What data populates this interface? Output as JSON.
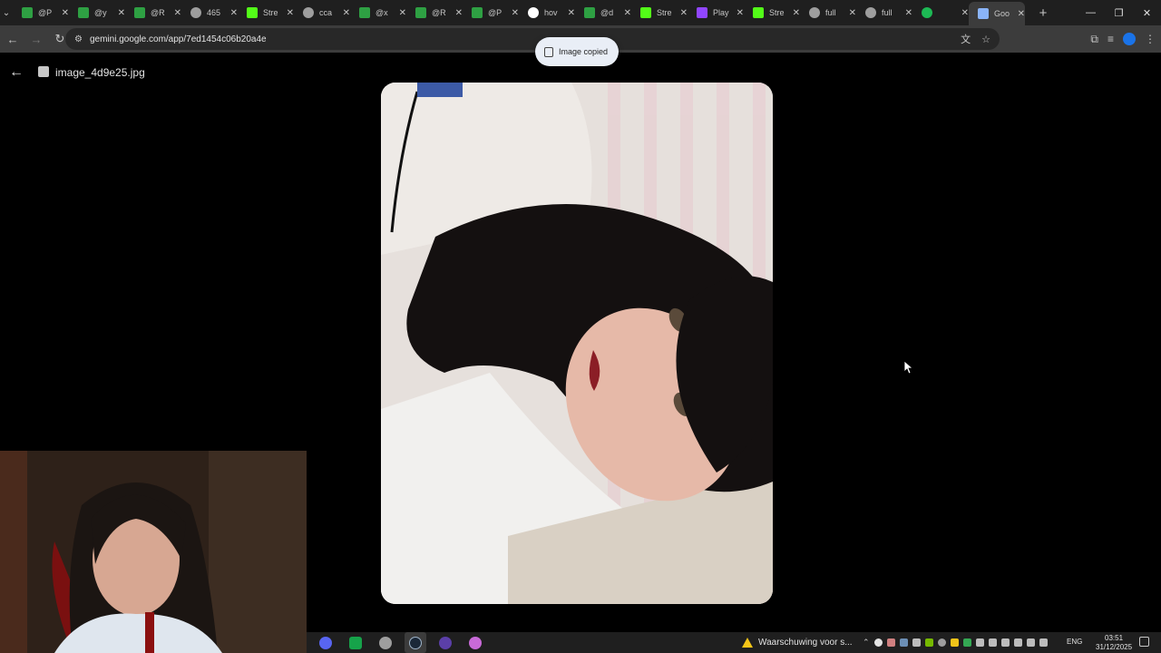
{
  "browser": {
    "tabs": [
      {
        "title": "@P",
        "favicon": "green-square-icon",
        "color": "#2ea043"
      },
      {
        "title": "@y",
        "favicon": "green-square-icon",
        "color": "#2ea043"
      },
      {
        "title": "@R",
        "favicon": "green-square-icon",
        "color": "#2ea043"
      },
      {
        "title": "465",
        "favicon": "globe-icon",
        "color": "#9e9e9e"
      },
      {
        "title": "Stre",
        "favicon": "kick-icon",
        "color": "#53fc18"
      },
      {
        "title": "cca",
        "favicon": "globe-icon",
        "color": "#9e9e9e"
      },
      {
        "title": "@x",
        "favicon": "green-square-icon",
        "color": "#2ea043"
      },
      {
        "title": "@R",
        "favicon": "green-square-icon",
        "color": "#2ea043"
      },
      {
        "title": "@P",
        "favicon": "green-square-icon",
        "color": "#2ea043"
      },
      {
        "title": "hov",
        "favicon": "google-icon",
        "color": "#ffffff"
      },
      {
        "title": "@d",
        "favicon": "green-square-icon",
        "color": "#2ea043"
      },
      {
        "title": "Stre",
        "favicon": "kick-icon",
        "color": "#53fc18"
      },
      {
        "title": "Play",
        "favicon": "s-icon",
        "color": "#9146ff"
      },
      {
        "title": "Stre",
        "favicon": "kick-icon",
        "color": "#53fc18"
      },
      {
        "title": "full",
        "favicon": "globe-icon",
        "color": "#9e9e9e"
      },
      {
        "title": "full",
        "favicon": "globe-icon",
        "color": "#9e9e9e"
      },
      {
        "title": "",
        "favicon": "spotify-icon",
        "color": "#1db954"
      },
      {
        "title": "Goo",
        "favicon": "gemini-icon",
        "color": "#8ab4f8",
        "active": true
      }
    ],
    "url": "gemini.google.com/app/7ed1454c06b20a4e"
  },
  "toast": {
    "text": "Image copied"
  },
  "viewer": {
    "filename": "image_4d9e25.jpg"
  },
  "taskbar": {
    "warning_text": "Waarschuwing voor s...",
    "language": "ENG",
    "time": "03:51",
    "date": "31/12/2025"
  }
}
